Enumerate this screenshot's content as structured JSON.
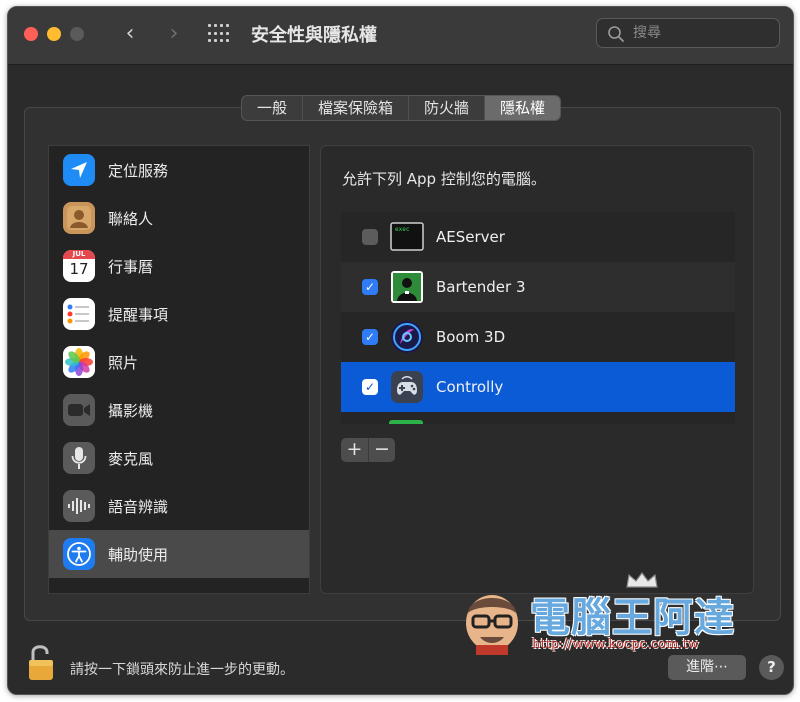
{
  "window": {
    "title": "安全性與隱私權",
    "search": {
      "placeholder": "搜尋",
      "value": ""
    }
  },
  "tabs": [
    {
      "label": "一般",
      "active": false
    },
    {
      "label": "檔案保險箱",
      "active": false
    },
    {
      "label": "防火牆",
      "active": false
    },
    {
      "label": "隱私權",
      "active": true
    }
  ],
  "sidebar": {
    "items": [
      {
        "label": "定位服務",
        "icon": "location-arrow-icon"
      },
      {
        "label": "聯絡人",
        "icon": "contacts-icon"
      },
      {
        "label": "行事曆",
        "icon": "calendar-icon",
        "icon_month": "JUL",
        "icon_day": "17"
      },
      {
        "label": "提醒事項",
        "icon": "reminders-icon"
      },
      {
        "label": "照片",
        "icon": "photos-icon"
      },
      {
        "label": "攝影機",
        "icon": "camera-icon"
      },
      {
        "label": "麥克風",
        "icon": "microphone-icon"
      },
      {
        "label": "語音辨識",
        "icon": "speech-recognition-icon"
      },
      {
        "label": "輔助使用",
        "icon": "accessibility-icon",
        "selected": true
      }
    ]
  },
  "panel": {
    "heading": "允許下列 App 控制您的電腦。",
    "apps": [
      {
        "name": "AEServer",
        "checked": false,
        "icon": "terminal-exec-icon",
        "icon_text": "exec"
      },
      {
        "name": "Bartender 3",
        "checked": true,
        "icon": "bartender-icon"
      },
      {
        "name": "Boom 3D",
        "checked": true,
        "icon": "boom-3d-icon"
      },
      {
        "name": "Controlly",
        "checked": true,
        "icon": "gamepad-icon",
        "selected": true
      }
    ],
    "add_label": "+",
    "remove_label": "−"
  },
  "footer": {
    "lock_text": "請按一下鎖頭來防止進一步的更動。",
    "advanced_label": "進階⋯",
    "help_label": "?"
  },
  "watermark": {
    "title": "電腦王阿達",
    "url": "http://www.kocpc.com.tw"
  },
  "colors": {
    "selection_blue": "#0b5ad6",
    "checkbox_blue": "#2f7cf6",
    "window_bg": "#2b2b2b",
    "close": "#ff5f57",
    "minimize": "#febc2e"
  }
}
